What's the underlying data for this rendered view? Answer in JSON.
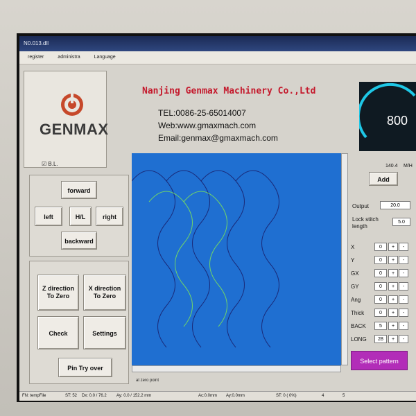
{
  "window": {
    "title": "N0.013.dll"
  },
  "menu": {
    "items": [
      "register",
      "administra",
      "Language"
    ]
  },
  "brand": {
    "logo_text": "GENMAX",
    "company": "Nanjing Genmax Machinery Co.,Ltd",
    "tel": "TEL:0086-25-65014007",
    "web": "Web:www.gmaxmach.com",
    "email": "Email:genmax@gmaxmach.com"
  },
  "bl": {
    "label": "B.L."
  },
  "move": {
    "forward": "forward",
    "left": "left",
    "hl": "H/L",
    "right": "right",
    "backward": "backward"
  },
  "actions": {
    "z_zero": "Z direction\nTo Zero",
    "x_zero": "X direction\nTo Zero",
    "check": "Check",
    "settings": "Settings",
    "pin": "Pin Try over"
  },
  "canvas_status": "at zero point",
  "gauge": {
    "value": "800",
    "speed": "140.4",
    "unit": "M/H",
    "add": "Add"
  },
  "settings_panel": {
    "output_label": "Output",
    "output_value": "20.0",
    "lock_label": "Lock stitch\nlength",
    "lock_value": "5.0",
    "rows": [
      {
        "label": "X",
        "value": "0"
      },
      {
        "label": "Y",
        "value": "0"
      },
      {
        "label": "GX",
        "value": "0"
      },
      {
        "label": "GY",
        "value": "0"
      },
      {
        "label": "Ang",
        "value": "0"
      },
      {
        "label": "Thick",
        "value": "0"
      },
      {
        "label": "BACK",
        "value": "5"
      },
      {
        "label": "LONG",
        "value": "28"
      }
    ],
    "select_pattern": "Select pattern"
  },
  "statusbar": {
    "file": "FN: tempFile",
    "st": "ST: 52",
    "dx": "Dx: 0.0 / 76.2",
    "dy": "Ay: 0.0 / 152.2 mm",
    "ac": "Ac:0.0mm",
    "ay": "Ay:0.0mm",
    "st2": "ST: 0 ( 0%)",
    "p1": "4",
    "p2": "5"
  },
  "colors": {
    "canvas_bg": "#1f6fd1",
    "title_red": "#c4192c",
    "select_purple": "#b22db8"
  }
}
